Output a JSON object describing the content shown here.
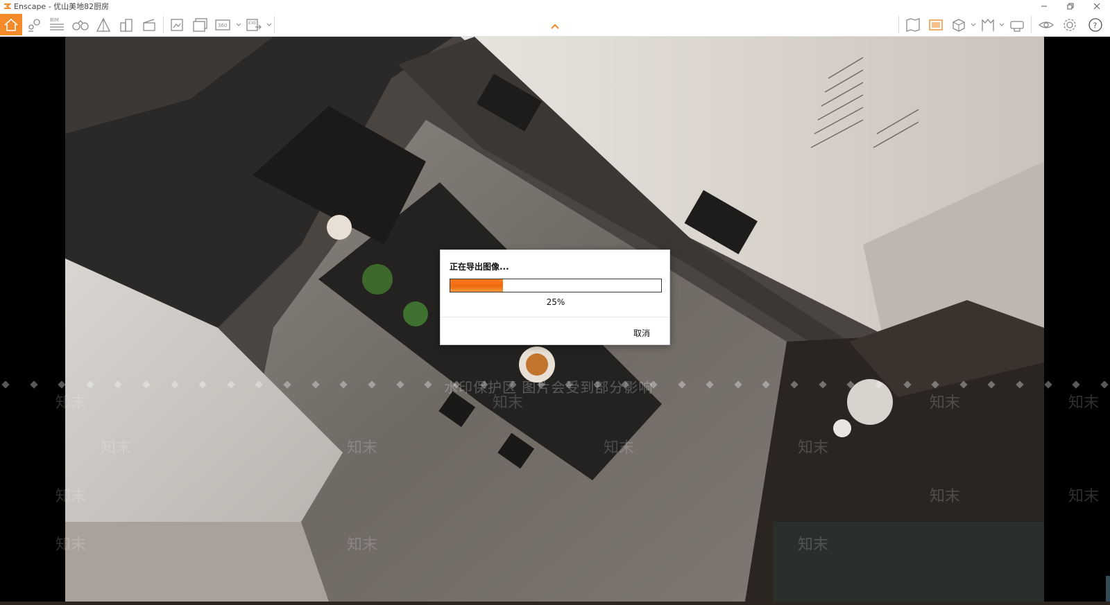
{
  "window": {
    "title": "Enscape - 优山美地82厨房",
    "controls": [
      "minimize",
      "restore",
      "close"
    ]
  },
  "toolbar": {
    "left_buttons": [
      {
        "icon": "home-icon",
        "active": true
      },
      {
        "icon": "map-pin-icon"
      },
      {
        "icon": "bim-icon",
        "label": "BIM"
      },
      {
        "icon": "binoculars-icon"
      },
      {
        "icon": "perspective-icon"
      },
      {
        "icon": "buildings-icon"
      },
      {
        "icon": "clapperboard-icon"
      },
      {
        "icon": "screenshot-icon"
      },
      {
        "icon": "batch-render-icon"
      },
      {
        "icon": "panorama-360-icon",
        "label": "360"
      },
      {
        "icon": "export-exe-icon",
        "label": "EXE"
      }
    ],
    "right_buttons": [
      {
        "icon": "map-icon"
      },
      {
        "icon": "image-frame-icon",
        "active_color": "#f58a2a"
      },
      {
        "icon": "cube-icon"
      },
      {
        "icon": "asset-library-icon"
      },
      {
        "icon": "vr-headset-icon"
      },
      {
        "icon": "eye-icon"
      },
      {
        "icon": "settings-gear-icon"
      },
      {
        "icon": "help-icon"
      }
    ]
  },
  "overlay": {
    "watermark_text": "水印保护区  图片会受到部分影响",
    "watermark_logo": "知末"
  },
  "dialog": {
    "title": "正在导出图像...",
    "progress_percent": 25,
    "progress_label": "25%",
    "cancel_label": "取消"
  },
  "colors": {
    "accent": "#f58a2a",
    "progress_fill": "#f06a10"
  }
}
